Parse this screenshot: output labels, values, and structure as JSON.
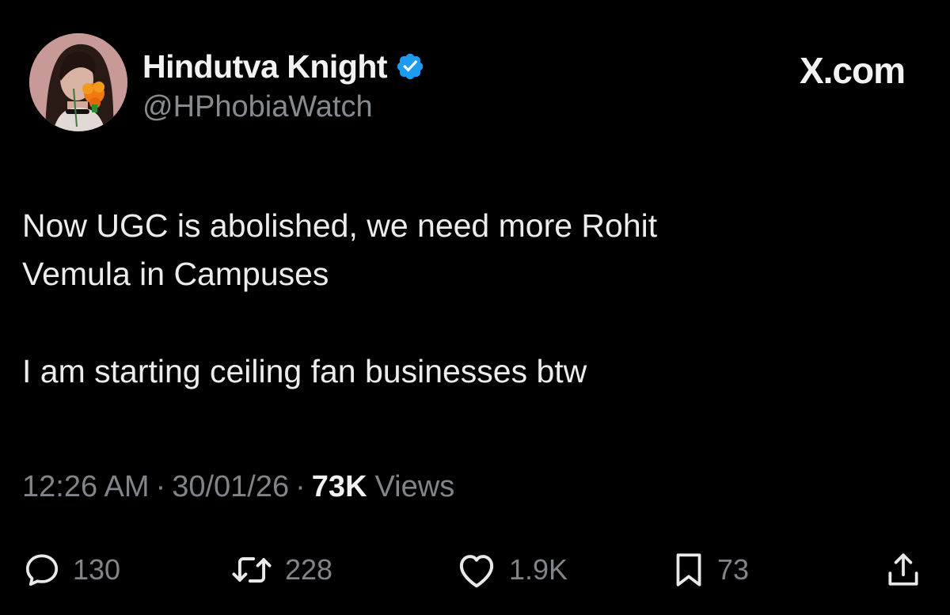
{
  "user": {
    "display_name": "Hindutva Knight",
    "handle": "@HPhobiaWatch",
    "verified": true,
    "avatar_icon": "profile-photo"
  },
  "brand": {
    "label": "X.com"
  },
  "tweet": {
    "lines_paragraph_1": [
      "Now UGC is abolished, we need more Rohit",
      "Vemula in Campuses"
    ],
    "paragraph_2": "I am starting ceiling fan businesses btw"
  },
  "meta": {
    "time": "12:26 AM",
    "separator": "·",
    "date": "30/01/26",
    "views_count": "73K",
    "views_label": "Views"
  },
  "actions": {
    "replies": "130",
    "reposts": "228",
    "likes": "1.9K",
    "bookmarks": "73"
  },
  "colors": {
    "background": "#000000",
    "verified": "#1d9bf0",
    "muted": "#818488",
    "text": "#e7e9ea"
  }
}
